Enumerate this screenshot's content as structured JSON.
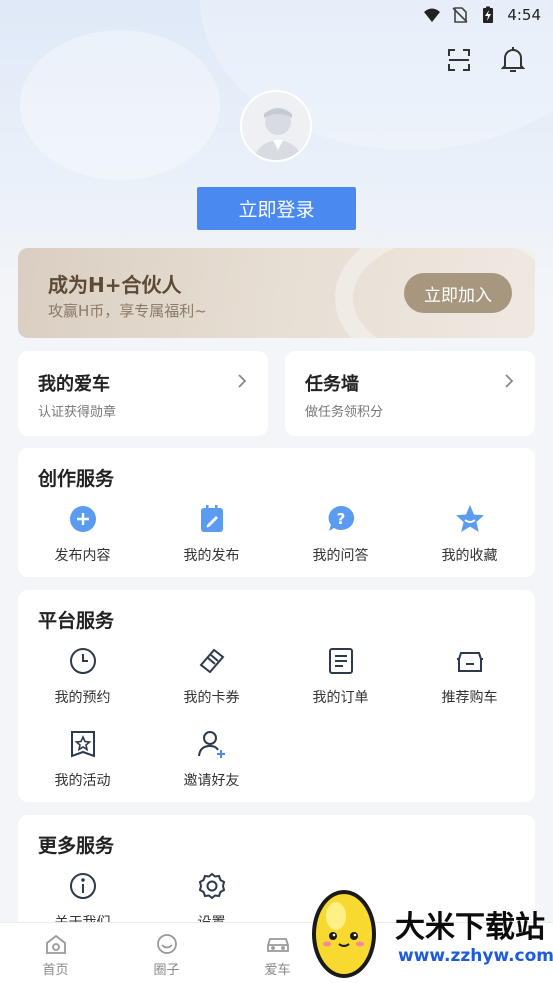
{
  "status_bar": {
    "time": "4:54",
    "icons": [
      "wifi-icon",
      "no-sim-icon",
      "battery-charging-icon"
    ]
  },
  "header_icons": [
    "scan-icon",
    "bell-icon"
  ],
  "profile": {
    "avatar": "avatar-placeholder",
    "login_label": "立即登录"
  },
  "partner_banner": {
    "title": "成为H+合伙人",
    "subtitle": "攻赢H币，享专属福利~",
    "button_label": "立即加入"
  },
  "quick_cards": [
    {
      "title": "我的爱车",
      "subtitle": "认证获得勋章"
    },
    {
      "title": "任务墙",
      "subtitle": "做任务领积分"
    }
  ],
  "creation_services": {
    "title": "创作服务",
    "items": [
      {
        "label": "发布内容",
        "icon": "plus-circle-icon"
      },
      {
        "label": "我的发布",
        "icon": "edit-note-icon"
      },
      {
        "label": "我的问答",
        "icon": "question-bubble-icon"
      },
      {
        "label": "我的收藏",
        "icon": "star-icon"
      }
    ]
  },
  "platform_services": {
    "title": "平台服务",
    "items": [
      {
        "label": "我的预约",
        "icon": "clock-icon"
      },
      {
        "label": "我的卡券",
        "icon": "ticket-icon"
      },
      {
        "label": "我的订单",
        "icon": "order-list-icon"
      },
      {
        "label": "推荐购车",
        "icon": "car-front-icon"
      },
      {
        "label": "我的活动",
        "icon": "star-bookmark-icon"
      },
      {
        "label": "邀请好友",
        "icon": "add-user-icon"
      }
    ]
  },
  "more_services": {
    "title": "更多服务",
    "items": [
      {
        "label": "关于我们",
        "icon": "info-icon"
      },
      {
        "label": "设置",
        "icon": "gear-icon"
      }
    ]
  },
  "tab_bar": {
    "items": [
      {
        "label": "首页",
        "icon": "home-icon"
      },
      {
        "label": "圈子",
        "icon": "circle-icon"
      },
      {
        "label": "爱车",
        "icon": "car-icon"
      }
    ]
  },
  "watermark": {
    "text": "大米下载站",
    "url": "www.zzhyw.com"
  },
  "colors": {
    "primary": "#4a8af0",
    "icon_blue": "#5b9cf0",
    "partner_gold": "#a8977f"
  }
}
